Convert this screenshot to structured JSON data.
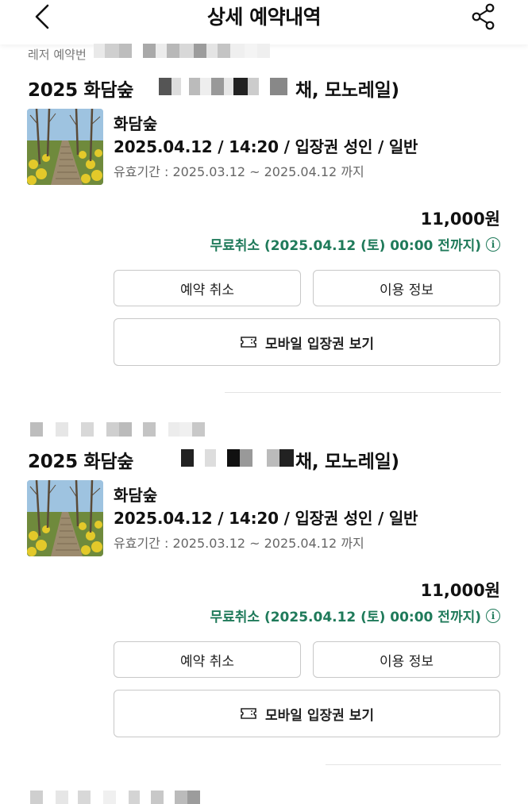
{
  "header": {
    "title": "상세 예약내역",
    "back_icon": "chevron-left-icon",
    "share_icon": "share-icon"
  },
  "bookings": [
    {
      "category": "레저 예약번",
      "title_prefix": "2025 화담숲",
      "title_suffix": "채, 모노레일)",
      "place": "화담숲",
      "detail": "2025.04.12 / 14:20 / 입장권 성인 / 일반",
      "validity": "유효기간 : 2025.03.12 ~ 2025.04.12 까지",
      "price": "11,000원",
      "cancel_note": "무료취소 (2025.04.12 (토) 00:00 전까지)",
      "cancel_button": "예약 취소",
      "info_button": "이용 정보",
      "ticket_button": "모바일 입장권 보기"
    },
    {
      "title_prefix": "2025 화담숲",
      "title_suffix": "채, 모노레일)",
      "place": "화담숲",
      "detail": "2025.04.12 / 14:20 / 입장권 성인 / 일반",
      "validity": "유효기간 : 2025.03.12 ~ 2025.04.12 까지",
      "price": "11,000원",
      "cancel_note": "무료취소 (2025.04.12 (토) 00:00 전까지)",
      "cancel_button": "예약 취소",
      "info_button": "이용 정보",
      "ticket_button": "모바일 입장권 보기"
    }
  ],
  "colors": {
    "accent_green": "#1f7a5a",
    "border": "#c8c8c8"
  }
}
